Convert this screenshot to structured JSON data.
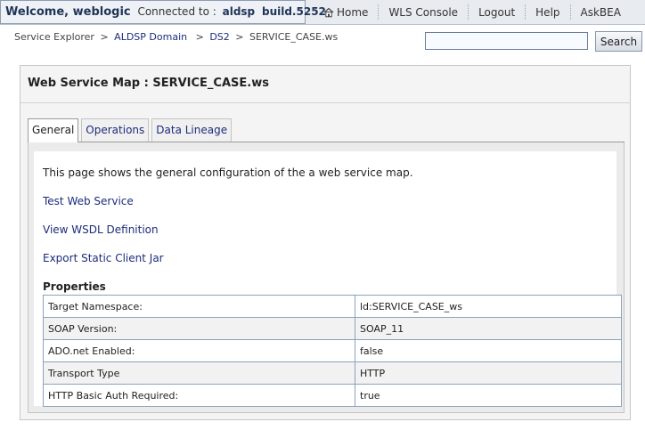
{
  "header": {
    "welcome": "Welcome, weblogic",
    "connected_label": "Connected to :",
    "server": "aldsp",
    "build": "build.5252",
    "nav": [
      {
        "label": "Home",
        "icon": "home-icon"
      },
      {
        "label": "WLS Console"
      },
      {
        "label": "Logout"
      },
      {
        "label": "Help"
      },
      {
        "label": "AskBEA"
      }
    ]
  },
  "breadcrumb": {
    "items": [
      "Service Explorer",
      "ALDSP Domain",
      "DS2",
      "SERVICE_CASE.ws"
    ],
    "separator": ">"
  },
  "search": {
    "value": "",
    "button_label": "Search"
  },
  "panel": {
    "title": "Web Service Map : SERVICE_CASE.ws",
    "tabs": [
      {
        "label": "General",
        "active": true
      },
      {
        "label": "Operations",
        "active": false
      },
      {
        "label": "Data Lineage",
        "active": false
      }
    ],
    "intro": "This page shows the general configuration of the a web service map.",
    "links": [
      "Test Web Service",
      "View WSDL Definition",
      "Export Static Client Jar"
    ],
    "properties_heading": "Properties",
    "properties": [
      {
        "key": "Target Namespace:",
        "value": "ld:SERVICE_CASE_ws"
      },
      {
        "key": "SOAP Version:",
        "value": "SOAP_11"
      },
      {
        "key": "ADO.net Enabled:",
        "value": "false"
      },
      {
        "key": "Transport Type",
        "value": "HTTP"
      },
      {
        "key": "HTTP Basic Auth Required:",
        "value": "true"
      }
    ]
  },
  "colors": {
    "link": "#1c2d7a",
    "header_bg": "#e8ebf0",
    "table_border": "#8ba2bd"
  }
}
